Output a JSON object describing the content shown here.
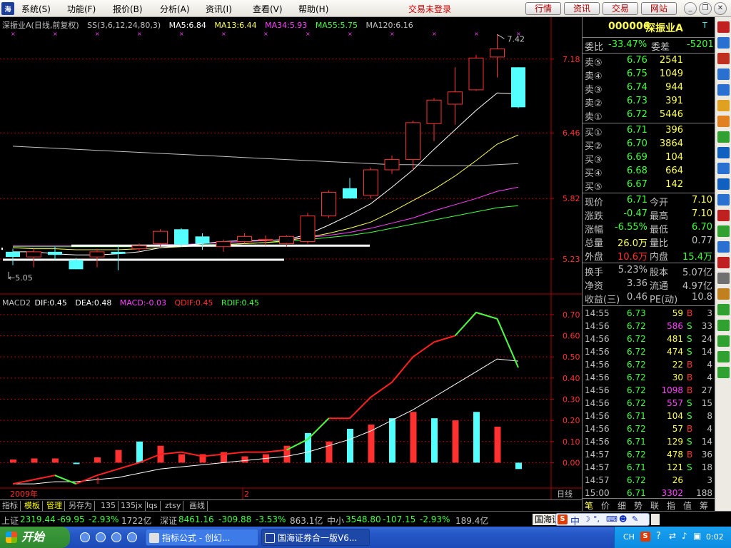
{
  "menu": {
    "items": [
      "系统(S)",
      "功能(F)",
      "报价(B)",
      "分析(A)",
      "资讯(I)",
      "查看(V)",
      "帮助(H)"
    ],
    "trade_status": "交易未登录",
    "buttons": [
      "行情",
      "资讯",
      "交易",
      "网站"
    ]
  },
  "chart": {
    "legend_main": {
      "title": "深振业A",
      "mode": "(日线,前复权)",
      "ss": "SS(3,6,12,24,80,3)",
      "ma5": "MA5:6.84",
      "ma13": "MA13:6.44",
      "ma34": "MA34:5.93",
      "ma55": "MA55:5.75",
      "ma120": "MA120:6.16"
    },
    "legend_macd": {
      "name": "MACD2",
      "dif": "DIF:0.45",
      "dea": "DEA:0.48",
      "macd": "MACD:-0.03",
      "qdif": "QDIF:0.45",
      "rdif": "RDIF:0.45"
    },
    "max_label": "7.42",
    "min_label": "5.05",
    "year_label": "2009年",
    "month_label": "2",
    "period_label": "日线",
    "colors": {
      "up": "#ff3030",
      "down": "#54ffff",
      "ma5": "#ffffff",
      "ma13": "#ffff54",
      "ma34": "#ff40ff",
      "ma55": "#40ff40",
      "ma120": "#c0c0c0",
      "axis": "#b00000"
    }
  },
  "chart_data": {
    "type": "candlestick",
    "price_axis": {
      "ticks": [
        7.18,
        6.46,
        5.82,
        5.23
      ],
      "ylim": [
        5.0,
        7.45
      ]
    },
    "macd_axis": {
      "ticks": [
        0.7,
        0.6,
        0.5,
        0.4,
        0.3,
        0.2,
        0.1,
        0.0
      ],
      "ylim": [
        -0.12,
        0.74
      ]
    },
    "candles": [
      {
        "o": 5.3,
        "h": 5.33,
        "l": 5.17,
        "c": 5.25
      },
      {
        "o": 5.25,
        "h": 5.33,
        "l": 5.15,
        "c": 5.3
      },
      {
        "o": 5.3,
        "h": 5.35,
        "l": 5.22,
        "c": 5.27
      },
      {
        "o": 5.22,
        "h": 5.24,
        "l": 5.13,
        "c": 5.13
      },
      {
        "o": 5.25,
        "h": 5.33,
        "l": 5.15,
        "c": 5.3
      },
      {
        "o": 5.3,
        "h": 5.36,
        "l": 5.12,
        "c": 5.28
      },
      {
        "o": 5.33,
        "h": 5.38,
        "l": 5.3,
        "c": 5.36
      },
      {
        "o": 5.38,
        "h": 5.52,
        "l": 5.35,
        "c": 5.5
      },
      {
        "o": 5.52,
        "h": 5.53,
        "l": 5.35,
        "c": 5.37
      },
      {
        "o": 5.45,
        "h": 5.48,
        "l": 5.32,
        "c": 5.38
      },
      {
        "o": 5.35,
        "h": 5.42,
        "l": 5.3,
        "c": 5.4
      },
      {
        "o": 5.4,
        "h": 5.48,
        "l": 5.38,
        "c": 5.45
      },
      {
        "o": 5.42,
        "h": 5.46,
        "l": 5.36,
        "c": 5.42
      },
      {
        "o": 5.38,
        "h": 5.46,
        "l": 5.35,
        "c": 5.45
      },
      {
        "o": 5.4,
        "h": 5.68,
        "l": 5.38,
        "c": 5.65
      },
      {
        "o": 5.65,
        "h": 5.9,
        "l": 5.63,
        "c": 5.88
      },
      {
        "o": 5.92,
        "h": 6.02,
        "l": 5.84,
        "c": 5.82
      },
      {
        "o": 5.85,
        "h": 6.12,
        "l": 5.82,
        "c": 6.1
      },
      {
        "o": 6.1,
        "h": 6.24,
        "l": 6.06,
        "c": 6.2
      },
      {
        "o": 6.2,
        "h": 6.58,
        "l": 6.1,
        "c": 6.56
      },
      {
        "o": 6.55,
        "h": 6.8,
        "l": 6.38,
        "c": 6.78
      },
      {
        "o": 6.74,
        "h": 7.1,
        "l": 6.54,
        "c": 6.86
      },
      {
        "o": 6.88,
        "h": 7.22,
        "l": 6.87,
        "c": 7.19
      },
      {
        "o": 7.2,
        "h": 7.42,
        "l": 7.0,
        "c": 7.28
      },
      {
        "o": 7.1,
        "h": 7.1,
        "l": 6.7,
        "c": 6.71
      }
    ],
    "ma5": [
      5.3,
      5.3,
      5.28,
      5.27,
      5.27,
      5.28,
      5.3,
      5.34,
      5.36,
      5.38,
      5.4,
      5.41,
      5.41,
      5.42,
      5.47,
      5.56,
      5.66,
      5.77,
      5.93,
      6.1,
      6.3,
      6.49,
      6.68,
      6.85,
      6.84
    ],
    "ma13": [
      5.34,
      5.33,
      5.33,
      5.32,
      5.32,
      5.32,
      5.33,
      5.34,
      5.35,
      5.36,
      5.37,
      5.38,
      5.39,
      5.41,
      5.44,
      5.48,
      5.53,
      5.59,
      5.69,
      5.8,
      5.91,
      6.04,
      6.19,
      6.35,
      6.44
    ],
    "ma34": [
      5.36,
      5.36,
      5.36,
      5.36,
      5.36,
      5.36,
      5.36,
      5.37,
      5.37,
      5.38,
      5.39,
      5.4,
      5.41,
      5.42,
      5.44,
      5.46,
      5.49,
      5.53,
      5.58,
      5.63,
      5.7,
      5.76,
      5.82,
      5.89,
      5.93
    ],
    "ma55": [
      5.35,
      5.35,
      5.35,
      5.35,
      5.35,
      5.35,
      5.35,
      5.36,
      5.36,
      5.37,
      5.37,
      5.38,
      5.39,
      5.4,
      5.42,
      5.44,
      5.46,
      5.49,
      5.53,
      5.57,
      5.61,
      5.65,
      5.69,
      5.73,
      5.75
    ],
    "ma120": [
      6.33,
      6.32,
      6.31,
      6.3,
      6.29,
      6.28,
      6.27,
      6.26,
      6.25,
      6.24,
      6.23,
      6.22,
      6.21,
      6.2,
      6.19,
      6.18,
      6.17,
      6.16,
      6.15,
      6.15,
      6.14,
      6.14,
      6.14,
      6.15,
      6.16
    ],
    "macd_bars": [
      0.015,
      0.02,
      0.02,
      -0.005,
      0.025,
      0.06,
      0.1,
      0.08,
      0.04,
      0.04,
      0.05,
      0.03,
      0.04,
      0.08,
      0.14,
      0.1,
      0.16,
      0.18,
      0.21,
      0.24,
      0.21,
      0.2,
      0.24,
      0.17,
      -0.03
    ],
    "dif": [
      -0.1,
      -0.08,
      -0.06,
      -0.1,
      -0.06,
      -0.03,
      0.0,
      0.04,
      0.05,
      0.03,
      0.04,
      0.05,
      0.05,
      0.06,
      0.11,
      0.21,
      0.21,
      0.31,
      0.38,
      0.5,
      0.57,
      0.6,
      0.71,
      0.68,
      0.45
    ],
    "dea": [
      -0.1,
      -0.1,
      -0.09,
      -0.09,
      -0.08,
      -0.07,
      -0.05,
      -0.03,
      -0.02,
      -0.01,
      0.0,
      0.01,
      0.02,
      0.03,
      0.05,
      0.08,
      0.11,
      0.15,
      0.2,
      0.25,
      0.31,
      0.37,
      0.43,
      0.49,
      0.48
    ]
  },
  "quote": {
    "code": "000006",
    "name": "深振业A",
    "weibi_label": "委比",
    "weibi": "-33.47%",
    "weicha_label": "委差",
    "weicha": "-5201",
    "sells": [
      {
        "label": "卖⑤",
        "price": "6.76",
        "vol": "2541"
      },
      {
        "label": "卖④",
        "price": "6.75",
        "vol": "1049"
      },
      {
        "label": "卖③",
        "price": "6.74",
        "vol": "944"
      },
      {
        "label": "卖②",
        "price": "6.73",
        "vol": "391"
      },
      {
        "label": "卖①",
        "price": "6.72",
        "vol": "5446"
      }
    ],
    "buys": [
      {
        "label": "买①",
        "price": "6.71",
        "vol": "396"
      },
      {
        "label": "买②",
        "price": "6.70",
        "vol": "3864"
      },
      {
        "label": "买③",
        "price": "6.69",
        "vol": "104"
      },
      {
        "label": "买④",
        "price": "6.68",
        "vol": "664"
      },
      {
        "label": "买⑤",
        "price": "6.67",
        "vol": "142"
      }
    ],
    "stats": [
      {
        "l1": "现价",
        "v1": "6.71",
        "c1": "#40ff40",
        "l2": "今开",
        "v2": "7.10",
        "c2": "#ffff54"
      },
      {
        "l1": "涨跌",
        "v1": "-0.47",
        "c1": "#40ff40",
        "l2": "最高",
        "v2": "7.10",
        "c2": "#ffff54"
      },
      {
        "l1": "涨幅",
        "v1": "-6.55%",
        "c1": "#40ff40",
        "l2": "最低",
        "v2": "6.70",
        "c2": "#40ff40"
      },
      {
        "l1": "总量",
        "v1": "26.0万",
        "c1": "#ffff54",
        "l2": "量比",
        "v2": "0.77",
        "c2": "#c0c0c0"
      },
      {
        "l1": "外盘",
        "v1": "10.6万",
        "c1": "#ff3030",
        "l2": "内盘",
        "v2": "15.4万",
        "c2": "#40ff40"
      }
    ],
    "stats2": [
      {
        "l1": "换手",
        "v1": "5.23%",
        "l2": "股本",
        "v2": "5.07亿"
      },
      {
        "l1": "净资",
        "v1": "3.36",
        "l2": "流通",
        "v2": "4.97亿"
      },
      {
        "l1": "收益(三)",
        "v1": "0.46",
        "l2": "PE(动)",
        "v2": "10.8"
      }
    ],
    "ticks": [
      {
        "t": "14:55",
        "p": "6.73",
        "v": "59",
        "s": "B",
        "n": "3"
      },
      {
        "t": "14:56",
        "p": "6.72",
        "v": "586",
        "s": "S",
        "n": "33"
      },
      {
        "t": "14:56",
        "p": "6.72",
        "v": "481",
        "s": "S",
        "n": "24"
      },
      {
        "t": "14:56",
        "p": "6.72",
        "v": "474",
        "s": "S",
        "n": "14"
      },
      {
        "t": "14:56",
        "p": "6.72",
        "v": "22",
        "s": "B",
        "n": "4"
      },
      {
        "t": "14:56",
        "p": "6.72",
        "v": "30",
        "s": "B",
        "n": "4"
      },
      {
        "t": "14:56",
        "p": "6.72",
        "v": "1098",
        "s": "B",
        "n": "27"
      },
      {
        "t": "14:56",
        "p": "6.72",
        "v": "557",
        "s": "S",
        "n": "15"
      },
      {
        "t": "14:56",
        "p": "6.71",
        "v": "104",
        "s": "S",
        "n": "8"
      },
      {
        "t": "14:56",
        "p": "6.72",
        "v": "57",
        "s": "B",
        "n": "4"
      },
      {
        "t": "14:56",
        "p": "6.71",
        "v": "129",
        "s": "S",
        "n": "14"
      },
      {
        "t": "14:57",
        "p": "6.72",
        "v": "478",
        "s": "B",
        "n": "36"
      },
      {
        "t": "14:57",
        "p": "6.71",
        "v": "121",
        "s": "S",
        "n": "18"
      },
      {
        "t": "14:57",
        "p": "6.72",
        "v": "26",
        "s": "",
        "n": "3"
      },
      {
        "t": "15:00",
        "p": "6.71",
        "v": "3302",
        "s": "",
        "n": "188"
      }
    ],
    "bottom_tabs": [
      "笔",
      "价",
      "细",
      "势",
      "联",
      "指",
      "值",
      "筹"
    ]
  },
  "chart_tabs": [
    "指标",
    "模板",
    "管理",
    "另存为",
    "135",
    "135jx",
    "lqs",
    "ztsy",
    "画线"
  ],
  "ticker": {
    "sh_label": "上证",
    "sh_val": "2319.44",
    "sh_chg": "-69.95",
    "sh_pct": "-2.93%",
    "sh_amt": "1722亿",
    "sz_label": "深证",
    "sz_val": "8461.16",
    "sz_chg": "-309.88",
    "sz_pct": "-3.53%",
    "sz_amt": "863.1亿",
    "zx_label": "中小",
    "zx_val": "3548.80",
    "zx_chg": "-107.15",
    "zx_pct": "-2.93%",
    "zx_amt": "189.4亿",
    "tail": "国海证"
  },
  "taskbar": {
    "start": "开始",
    "tasks": [
      "指标公式 - 创幻...",
      "国海证券合一版V6..."
    ],
    "clock": "0:02",
    "lang": "CH"
  }
}
